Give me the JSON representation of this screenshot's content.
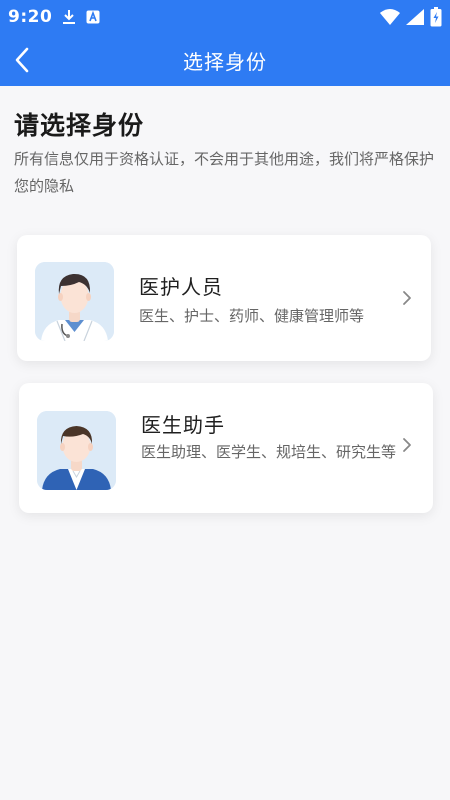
{
  "status_bar": {
    "time": "9:20"
  },
  "header": {
    "title": "选择身份"
  },
  "main": {
    "title": "请选择身份",
    "description": "所有信息仅用于资格认证，不会用于其他用途，我们将严格保护您的隐私",
    "cards": [
      {
        "title": "医护人员",
        "subtitle": "医生、护士、药师、健康管理师等"
      },
      {
        "title": "医生助手",
        "subtitle": "医生助理、医学生、规培生、研究生等"
      }
    ]
  },
  "colors": {
    "header_bg": "#2e7bf3",
    "avatar_bg": "#dceaf7"
  }
}
